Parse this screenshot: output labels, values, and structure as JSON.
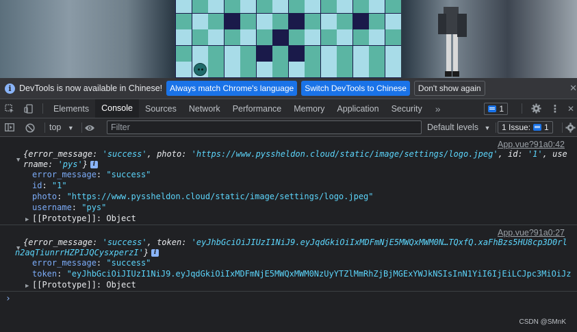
{
  "infobar": {
    "text": "DevTools is now available in Chinese!",
    "match_btn": "Always match Chrome's language",
    "switch_btn": "Switch DevTools to Chinese",
    "dismiss_btn": "Don't show again"
  },
  "tabs": [
    "Elements",
    "Console",
    "Sources",
    "Network",
    "Performance",
    "Memory",
    "Application",
    "Security"
  ],
  "active_tab": "Console",
  "message_count": "1",
  "toolbar": {
    "context": "top",
    "filter_placeholder": "Filter",
    "levels": "Default levels",
    "issue_label": "1 Issue:",
    "issue_count": "1"
  },
  "messages": [
    {
      "source": "App.vue?91a0:42",
      "summary_line1_parts": [
        "{error_message: ",
        "'success'",
        ", photo: ",
        "'https://www.pyssheldon.cloud/static/image/settings/logo.jpeg'",
        ", id: ",
        "'1'",
        ", use"
      ],
      "summary_line2_parts": [
        "rname: ",
        "'pys'",
        "}"
      ],
      "props": [
        {
          "key": "error_message",
          "value": "\"success\""
        },
        {
          "key": "id",
          "value": "\"1\""
        },
        {
          "key": "photo",
          "value": "\"https://www.pyssheldon.cloud/static/image/settings/logo.jpeg\""
        },
        {
          "key": "username",
          "value": "\"pys\""
        }
      ],
      "prototype": "[[Prototype]]",
      "prototype_value": "Object"
    },
    {
      "source": "App.vue?91a0:27",
      "summary_line1_parts": [
        "{error_message: ",
        "'success'",
        ", token: ",
        "'eyJhbGciOiJIUzI1NiJ9.eyJqdGkiOiIxMDFmNjE5MWQxMWM0N…TQxfQ.xaFhBzs5HU8cp3D0rl"
      ],
      "summary_line2_parts": [
        "n2aqTiunrrHZPIJQCysxperzI'",
        "}"
      ],
      "props": [
        {
          "key": "error_message",
          "value": "\"success\""
        },
        {
          "key": "token",
          "value": "\"eyJhbGciOiJIUzI1NiJ9.eyJqdGkiOiIxMDFmNjE5MWQxMWM0NzUyYTZlMmRhZjBjMGExYWJkNSIsInN1YiI6IjEiLCJpc3MiOiJz"
        }
      ],
      "prototype": "[[Prototype]]",
      "prototype_value": "Object"
    }
  ],
  "watermark": "CSDN @SMnK"
}
